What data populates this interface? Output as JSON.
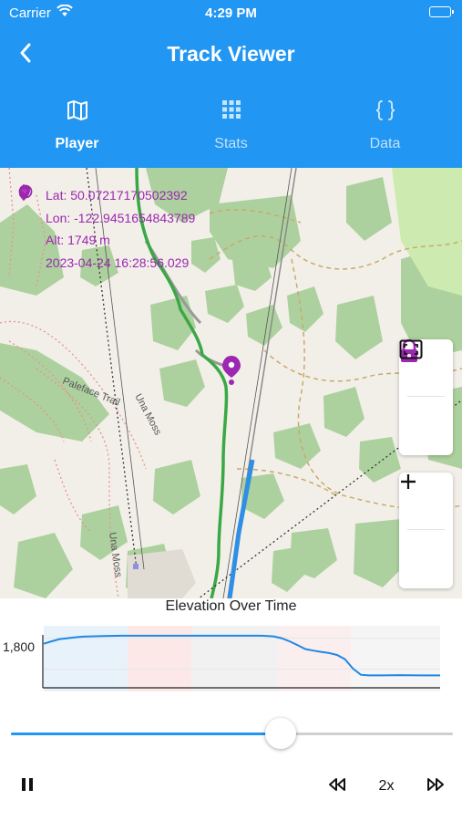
{
  "status_bar": {
    "carrier": "Carrier",
    "time": "4:29 PM",
    "wifi_icon": "wifi-icon",
    "battery_icon": "battery-icon"
  },
  "app_bar": {
    "title": "Track Viewer",
    "back_icon": "chevron-left-icon"
  },
  "tabs": [
    {
      "label": "Player",
      "icon": "map-icon",
      "active": true
    },
    {
      "label": "Stats",
      "icon": "grid-icon",
      "active": false
    },
    {
      "label": "Data",
      "icon": "braces-icon",
      "active": false
    }
  ],
  "map": {
    "info": {
      "lat": "Lat: 50.07217170502392",
      "lon": "Lon: -122.9451654843789",
      "alt": "Alt: 1749 m",
      "timestamp": "2023-04-24 16:28:56.029"
    },
    "labels": {
      "trail": "Paleface Trail",
      "moss_1": "Una Moss",
      "moss_2": "Una Moss"
    },
    "controls": {
      "lock_icon": "lock-icon",
      "fit_icon": "fit-screen-icon",
      "zoom_in_icon": "plus-icon",
      "zoom_out_icon": "minus-icon"
    },
    "colors": {
      "accent": "#9c27b0",
      "trail_green": "#3aa845",
      "lift_blue": "#2f8fe5"
    }
  },
  "chart_data": {
    "type": "line",
    "title": "Elevation Over Time",
    "xlabel": "",
    "ylabel": "",
    "y_ticks": [
      "1,800"
    ],
    "ylim": [
      1640,
      1840
    ],
    "x": [
      0,
      0.02,
      0.04,
      0.06,
      0.08,
      0.1,
      0.12,
      0.15,
      0.2,
      0.3,
      0.4,
      0.5,
      0.55,
      0.58,
      0.6,
      0.62,
      0.64,
      0.66,
      0.68,
      0.7,
      0.72,
      0.74,
      0.76,
      0.78,
      0.8,
      0.82,
      0.85,
      0.9,
      0.95,
      1.0
    ],
    "series": [
      {
        "values": [
          1782,
          1790,
          1797,
          1800,
          1803,
          1805,
          1806,
          1807,
          1808,
          1808,
          1808,
          1808,
          1808,
          1806,
          1800,
          1790,
          1778,
          1765,
          1760,
          1756,
          1752,
          1746,
          1732,
          1702,
          1682,
          1680,
          1680,
          1681,
          1680,
          1680
        ]
      }
    ],
    "grid": true
  },
  "playback": {
    "progress": 0.61,
    "speed": "2x",
    "pause_icon": "pause-icon",
    "rewind_icon": "rewind-icon",
    "forward_icon": "fast-forward-icon"
  }
}
